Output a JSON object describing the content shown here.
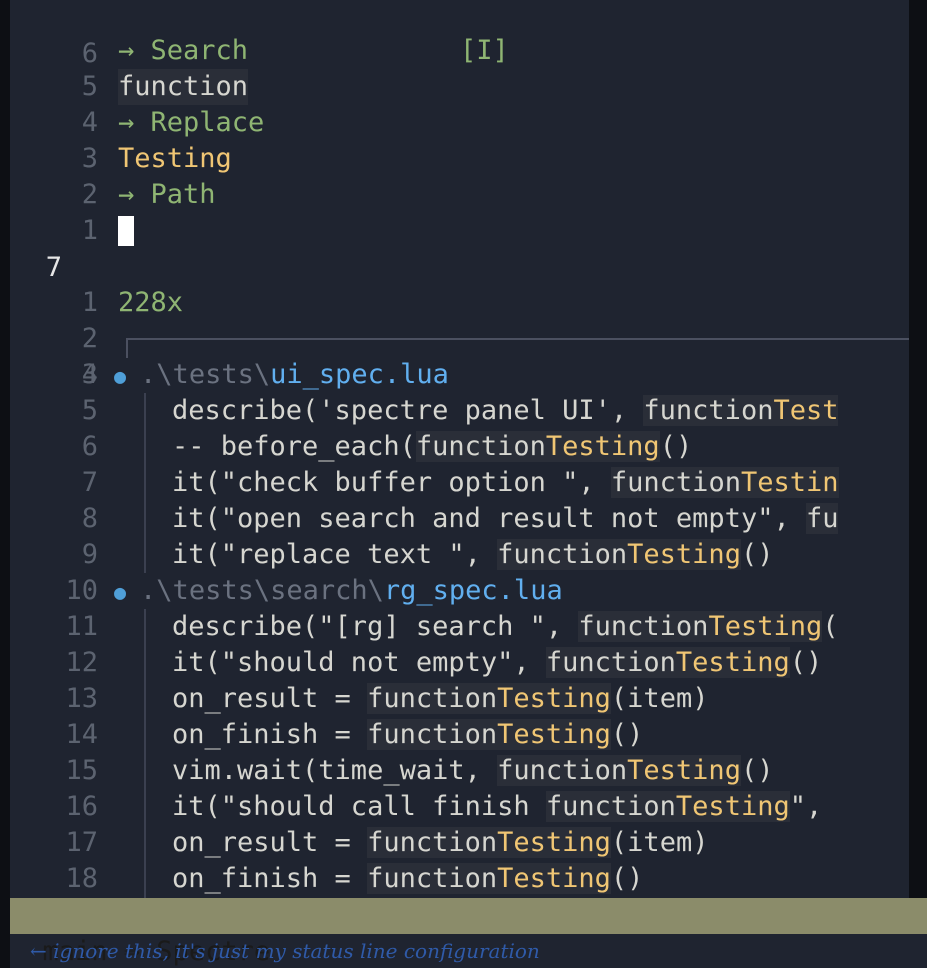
{
  "panel": {
    "search_label": "→ Search",
    "search_flag": "[I]",
    "search_value": "function",
    "replace_label": "→ Replace",
    "replace_value": "Testing",
    "path_label": "→ Path",
    "path_value": "",
    "match_count": "228x"
  },
  "line_numbers": {
    "header": [
      "6",
      "5",
      "4",
      "3",
      "2",
      "1"
    ],
    "current": "7",
    "after": [
      "1",
      "2",
      "3"
    ]
  },
  "results": [
    {
      "ln": "4",
      "type": "file",
      "bullet": "●",
      "dir": ".\\tests\\",
      "name": "ui_spec.lua"
    },
    {
      "ln": "5",
      "type": "match",
      "pre": "describe('spectre panel UI', ",
      "hl": "function",
      "repl": "Test",
      "post": ""
    },
    {
      "ln": "6",
      "type": "match",
      "pre": "-- before_each(",
      "hl": "function",
      "repl": "Testing",
      "post": "()"
    },
    {
      "ln": "7",
      "type": "match",
      "pre": "it(\"check buffer option \", ",
      "hl": "function",
      "repl": "Testin",
      "post": ""
    },
    {
      "ln": "8",
      "type": "match",
      "pre": "it(\"open search and result not empty\", ",
      "hl": "fu",
      "repl": "",
      "post": ""
    },
    {
      "ln": "9",
      "type": "match",
      "pre": "it(\"replace text \", ",
      "hl": "function",
      "repl": "Testing",
      "post": "()"
    },
    {
      "ln": "10",
      "type": "file",
      "bullet": "●",
      "dir": ".\\tests\\search\\",
      "name": "rg_spec.lua"
    },
    {
      "ln": "11",
      "type": "match",
      "pre": "describe(\"[rg] search \", ",
      "hl": "function",
      "repl": "Testing",
      "post": "("
    },
    {
      "ln": "12",
      "type": "match",
      "pre": "it(\"should not empty\", ",
      "hl": "function",
      "repl": "Testing",
      "post": "()"
    },
    {
      "ln": "13",
      "type": "match",
      "pre": "on_result = ",
      "hl": "function",
      "repl": "Testing",
      "post": "(item)"
    },
    {
      "ln": "14",
      "type": "match",
      "pre": "on_finish = ",
      "hl": "function",
      "repl": "Testing",
      "post": "()"
    },
    {
      "ln": "15",
      "type": "match",
      "pre": "vim.wait(time_wait, ",
      "hl": "function",
      "repl": "Testing",
      "post": "()"
    },
    {
      "ln": "16",
      "type": "match",
      "pre": "it(\"should call finish ",
      "hl": "function",
      "repl": "Testing",
      "post": "\","
    },
    {
      "ln": "17",
      "type": "match",
      "pre": "on_result = ",
      "hl": "function",
      "repl": "Testing",
      "post": "(item)"
    },
    {
      "ln": "18",
      "type": "match",
      "pre": "on_finish = ",
      "hl": "function",
      "repl": "Testing",
      "post": "()"
    }
  ],
  "statusline": {
    "text": "main ⇒ Spectre"
  },
  "annotation": {
    "text": "← ignore this, it's just my status line configuration"
  },
  "colors": {
    "background": "#1f2430",
    "label_green": "#8fb573",
    "replace_yellow": "#f0c674",
    "file_blue": "#61afef",
    "statusline_bg": "#8b8c6a"
  }
}
